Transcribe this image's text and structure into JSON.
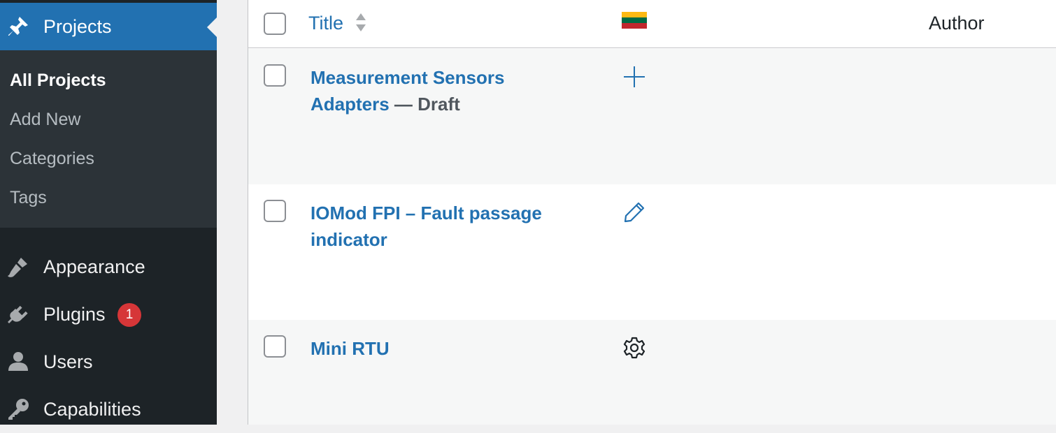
{
  "sidebar": {
    "current": {
      "label": "Projects",
      "icon": "pin-icon"
    },
    "submenu": [
      {
        "label": "All Projects",
        "current": true
      },
      {
        "label": "Add New",
        "current": false
      },
      {
        "label": "Categories",
        "current": false
      },
      {
        "label": "Tags",
        "current": false
      }
    ],
    "items": [
      {
        "label": "Appearance",
        "icon": "paintbrush-icon"
      },
      {
        "label": "Plugins",
        "icon": "plugin-icon",
        "badge": "1"
      },
      {
        "label": "Users",
        "icon": "user-icon"
      },
      {
        "label": "Capabilities",
        "icon": "key-icon"
      }
    ]
  },
  "table": {
    "columns": {
      "title": "Title",
      "language_flag": "lithuania-flag-icon",
      "author": "Author"
    },
    "rows": [
      {
        "title": "Measurement Sensors Adapters",
        "state": " — Draft",
        "lang_icon": "plus-icon"
      },
      {
        "title": "IOMod FPI – Fault passage indicator",
        "state": "",
        "lang_icon": "pencil-icon"
      },
      {
        "title": "Mini RTU",
        "state": "",
        "lang_icon": "gear-icon"
      }
    ]
  },
  "colors": {
    "sidebar_bg": "#1d2327",
    "submenu_bg": "#2c3338",
    "accent": "#2271b1",
    "badge": "#d63638"
  }
}
